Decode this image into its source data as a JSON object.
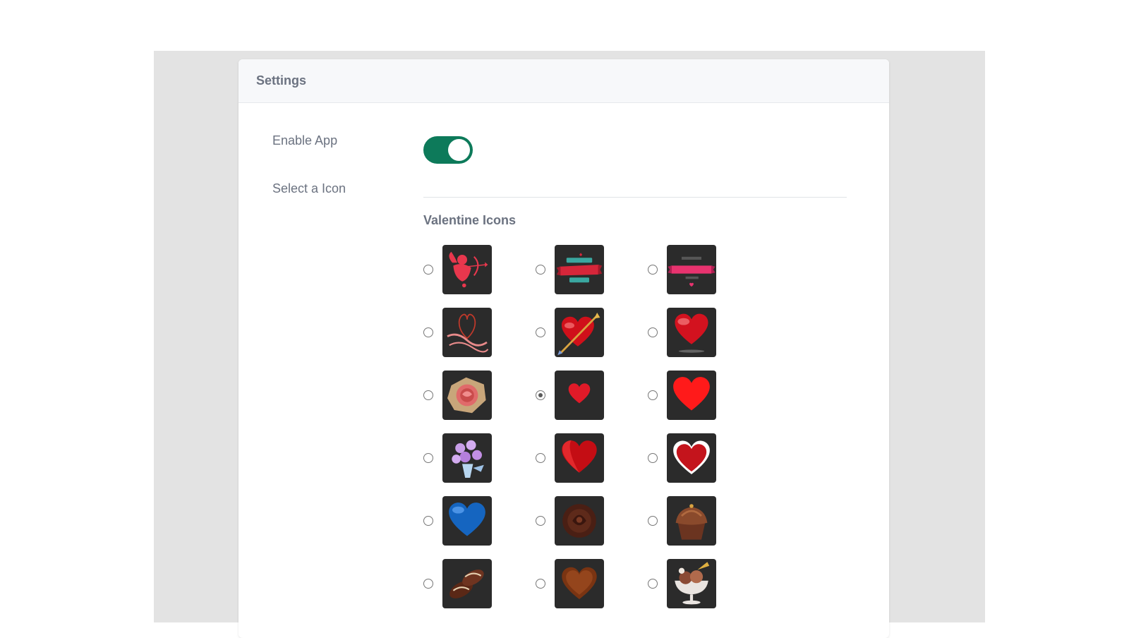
{
  "header": {
    "title": "Settings"
  },
  "settings": {
    "enable_app": {
      "label": "Enable App",
      "on": true,
      "color": "#0d7a5a"
    },
    "icon_select": {
      "label": "Select a Icon",
      "section_title": "Valentine Icons",
      "selected_index": 7
    }
  },
  "icons": [
    {
      "name": "cupid-icon"
    },
    {
      "name": "happy-valentines-day-banner-icon"
    },
    {
      "name": "happy-valentines-day-pink-ribbon-icon"
    },
    {
      "name": "happy-valentines-day-script-icon"
    },
    {
      "name": "heart-with-arrow-icon"
    },
    {
      "name": "glossy-red-heart-icon"
    },
    {
      "name": "rose-icon"
    },
    {
      "name": "small-red-heart-icon"
    },
    {
      "name": "flat-red-heart-icon"
    },
    {
      "name": "flower-bouquet-icon"
    },
    {
      "name": "shaded-red-heart-icon"
    },
    {
      "name": "white-outlined-red-heart-icon"
    },
    {
      "name": "blue-heart-icon"
    },
    {
      "name": "chocolate-rose-icon"
    },
    {
      "name": "chocolate-cupcake-icon"
    },
    {
      "name": "chocolate-pieces-icon"
    },
    {
      "name": "chocolate-heart-icon"
    },
    {
      "name": "ice-cream-sundae-icon"
    }
  ]
}
